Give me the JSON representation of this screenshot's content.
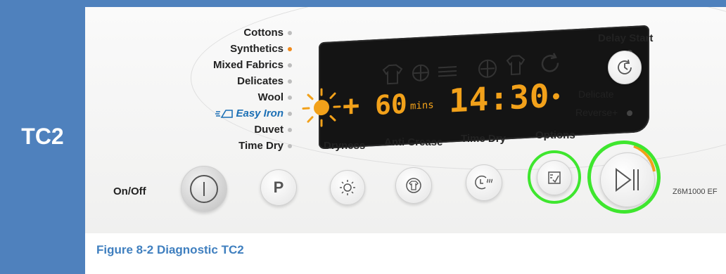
{
  "side": {
    "label": "TC2"
  },
  "programs": [
    "Cottons",
    "Synthetics",
    "Mixed Fabrics",
    "Delicates",
    "Wool",
    "Easy Iron",
    "Duvet",
    "Time Dry"
  ],
  "selected_program": "Synthetics",
  "display": {
    "time": "14:30",
    "duration": "60",
    "duration_unit": "mins",
    "plus": "+"
  },
  "option_labels": {
    "delay_start": "Delay Start",
    "delicate": "Delicate",
    "reverse": "Reverse+"
  },
  "button_labels": {
    "on_off": "On/Off",
    "program": "P",
    "dryness": "Dryness",
    "anti_crease": "Anti Crease",
    "time_dry": "Time Dry",
    "options": "Options"
  },
  "model": "Z6M1000 EF",
  "caption": "Figure 8-2 Diagnostic TC2",
  "colors": {
    "accent_blue": "#4f81bd",
    "display_amber": "#f2a11a",
    "highlight_green": "#3ee62e",
    "caption_blue": "#3f7fbf"
  }
}
